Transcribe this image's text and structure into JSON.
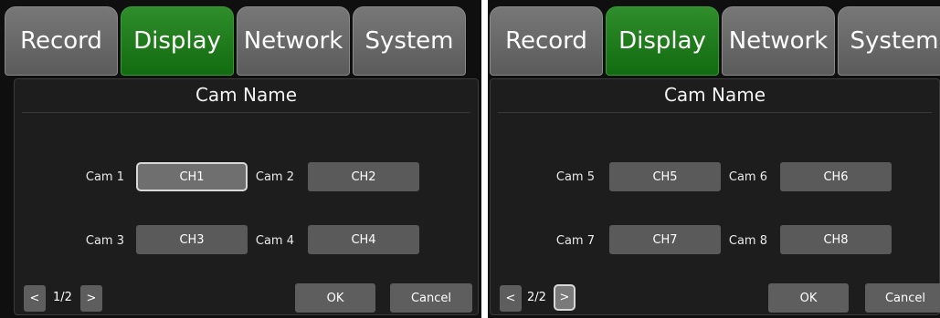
{
  "left": {
    "tabs": [
      {
        "label": "Record"
      },
      {
        "label": "Display"
      },
      {
        "label": "Network"
      },
      {
        "label": "System"
      }
    ],
    "title": "Cam Name",
    "cams": [
      {
        "label": "Cam 1",
        "value": "CH1"
      },
      {
        "label": "Cam 2",
        "value": "CH2"
      },
      {
        "label": "Cam 3",
        "value": "CH3"
      },
      {
        "label": "Cam 4",
        "value": "CH4"
      }
    ],
    "prev": "<",
    "page": "1/2",
    "next": ">",
    "ok": "OK",
    "cancel": "Cancel"
  },
  "right": {
    "tabs": [
      {
        "label": "Record"
      },
      {
        "label": "Display"
      },
      {
        "label": "Network"
      },
      {
        "label": "System"
      }
    ],
    "title": "Cam Name",
    "cams": [
      {
        "label": "Cam 5",
        "value": "CH5"
      },
      {
        "label": "Cam 6",
        "value": "CH6"
      },
      {
        "label": "Cam 7",
        "value": "CH7"
      },
      {
        "label": "Cam 8",
        "value": "CH8"
      }
    ],
    "prev": "<",
    "page": "2/2",
    "next": ">",
    "ok": "OK",
    "cancel": "Cancel"
  },
  "colors": {
    "active_tab": "#1a7a17",
    "tab": "#666666",
    "field": "#5a5a5a",
    "panel": "#1d1d1d"
  }
}
